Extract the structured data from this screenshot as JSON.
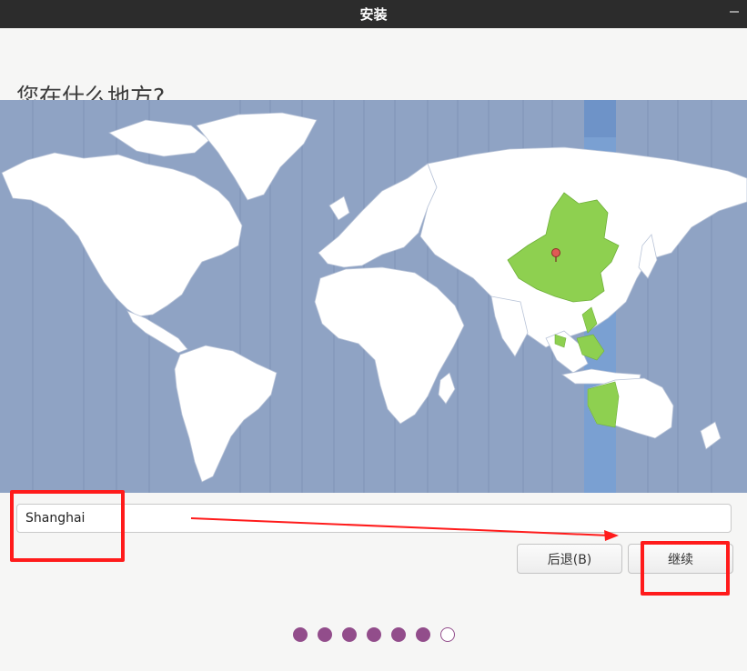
{
  "window": {
    "title": "安装"
  },
  "page": {
    "title": "您在什么地方?"
  },
  "timezone": {
    "value": "Shanghai"
  },
  "buttons": {
    "back_label": "后退(B)",
    "continue_label": "继续"
  },
  "progress": {
    "total_steps": 7,
    "completed_steps": 6,
    "current_step": 7
  },
  "colors": {
    "ocean": "#8fa3c4",
    "land": "#ffffff",
    "selected_zone": "#7aa0d2",
    "selected_region": "#8ed050",
    "marker": "#e05a55",
    "progress_dot": "#924d8b",
    "annotation": "#ff1b1b"
  }
}
